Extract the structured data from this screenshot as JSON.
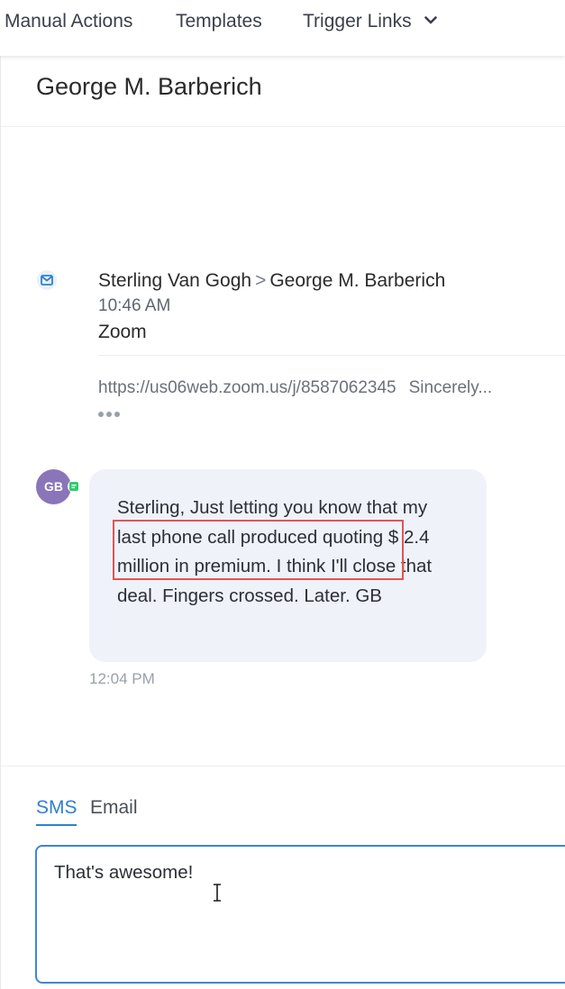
{
  "nav": {
    "manual_actions": "Manual Actions",
    "templates": "Templates",
    "trigger_links": "Trigger Links"
  },
  "conversation": {
    "contact_name": "George M. Barberich",
    "email": {
      "from": "Sterling Van Gogh",
      "separator": ">",
      "to": "George M. Barberich",
      "time": "10:46 AM",
      "subject": "Zoom",
      "preview_link": "https://us06web.zoom.us/j/8587062345",
      "preview_text": "Sincerely..."
    },
    "sms": {
      "avatar_initials": "GB",
      "message": "Sterling, Just letting you know that my last phone call produced quoting $ 2.4 million in premium. I think I'll close that deal. Fingers crossed. Later. GB",
      "time": "12:04 PM"
    }
  },
  "compose": {
    "tabs": [
      "SMS",
      "Email"
    ],
    "active_tab": "SMS",
    "value": "That's awesome!"
  },
  "colors": {
    "accent": "#2f80cf",
    "bubble_bg": "#eff2f9",
    "avatar_bg": "#8a75b9",
    "sms_badge": "#2ecc71",
    "highlight": "#e05555"
  }
}
